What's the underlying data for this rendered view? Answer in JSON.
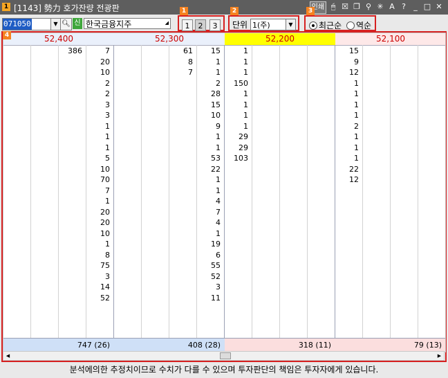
{
  "window": {
    "badge": "1",
    "title": "[1143] 勢力 호가잔량 전광판",
    "btn_text": "인쇄",
    "icons": [
      "mouse-icon",
      "close-box-icon",
      "restore-icon",
      "pin-icon",
      "star-icon",
      "font-icon",
      "help-icon",
      "minimize-icon",
      "maximize-icon",
      "close-icon"
    ]
  },
  "toolbar": {
    "stock_code": "071050",
    "credit_label": "신",
    "stock_name": "한국금융지주",
    "callouts": [
      "1",
      "2",
      "3",
      "4"
    ],
    "pages": [
      "1",
      "2",
      "3"
    ],
    "unit_label": "단위",
    "unit_value": "1(주)",
    "order_options": [
      "최근순",
      "역순"
    ],
    "order_selected": 0
  },
  "columns": [
    {
      "price": "52,400",
      "side": "ask",
      "values": [
        [
          "386",
          "7"
        ],
        [
          "",
          "20"
        ],
        [
          "",
          "10"
        ],
        [
          "",
          "2"
        ],
        [
          "",
          "2"
        ],
        [
          "",
          "3"
        ],
        [
          "",
          "3"
        ],
        [
          "",
          "1"
        ],
        [
          "",
          "1"
        ],
        [
          "",
          "1"
        ],
        [
          "",
          "5"
        ],
        [
          "",
          "10"
        ],
        [
          "",
          "70"
        ],
        [
          "",
          "7"
        ],
        [
          "",
          "1"
        ],
        [
          "",
          "20"
        ],
        [
          "",
          "20"
        ],
        [
          "",
          "10"
        ],
        [
          "",
          "1"
        ],
        [
          "",
          "8"
        ],
        [
          "",
          "75"
        ],
        [
          "",
          "3"
        ],
        [
          "",
          "14"
        ],
        [
          "",
          "52"
        ]
      ],
      "total": "747 (26)"
    },
    {
      "price": "52,300",
      "side": "ask",
      "values": [
        [
          "61",
          "15"
        ],
        [
          "8",
          "1"
        ],
        [
          "7",
          "1"
        ],
        [
          "",
          "2"
        ],
        [
          "",
          "28"
        ],
        [
          "",
          "15"
        ],
        [
          "",
          "10"
        ],
        [
          "",
          "9"
        ],
        [
          "",
          "1"
        ],
        [
          "",
          "1"
        ],
        [
          "",
          "53"
        ],
        [
          "",
          "22"
        ],
        [
          "",
          "1"
        ],
        [
          "",
          "1"
        ],
        [
          "",
          "4"
        ],
        [
          "",
          "7"
        ],
        [
          "",
          "4"
        ],
        [
          "",
          "1"
        ],
        [
          "",
          "19"
        ],
        [
          "",
          "6"
        ],
        [
          "",
          "55"
        ],
        [
          "",
          "52"
        ],
        [
          "",
          "3"
        ],
        [
          "",
          "11"
        ]
      ],
      "total": "408 (28)"
    },
    {
      "price": "52,200",
      "side": "bid",
      "values": [
        [
          "1",
          ""
        ],
        [
          "1",
          ""
        ],
        [
          "1",
          ""
        ],
        [
          "150",
          ""
        ],
        [
          "1",
          ""
        ],
        [
          "1",
          ""
        ],
        [
          "1",
          ""
        ],
        [
          "1",
          ""
        ],
        [
          "29",
          ""
        ],
        [
          "29",
          ""
        ],
        [
          "103",
          ""
        ]
      ],
      "total": "318 (11)"
    },
    {
      "price": "52,100",
      "side": "bid",
      "values": [
        [
          "15",
          ""
        ],
        [
          "9",
          ""
        ],
        [
          "12",
          ""
        ],
        [
          "1",
          ""
        ],
        [
          "1",
          ""
        ],
        [
          "1",
          ""
        ],
        [
          "1",
          ""
        ],
        [
          "2",
          ""
        ],
        [
          "1",
          ""
        ],
        [
          "1",
          ""
        ],
        [
          "1",
          ""
        ],
        [
          "22",
          ""
        ],
        [
          "12",
          ""
        ]
      ],
      "total": "79 (13)"
    }
  ],
  "colors": {
    "ask_header": "#eaf0fb",
    "ask_total": "#cfe0f7",
    "bid_header_current": "#ffff00",
    "bid_header": "#fde8e8",
    "bid_total": "#fbdede",
    "callout": "#f58220",
    "highlight_border": "#d62020"
  },
  "footer": "분석에의한 추정치이므로 수치가 다를 수 있으며 투자판단의 책임은 투자자에게 있습니다."
}
